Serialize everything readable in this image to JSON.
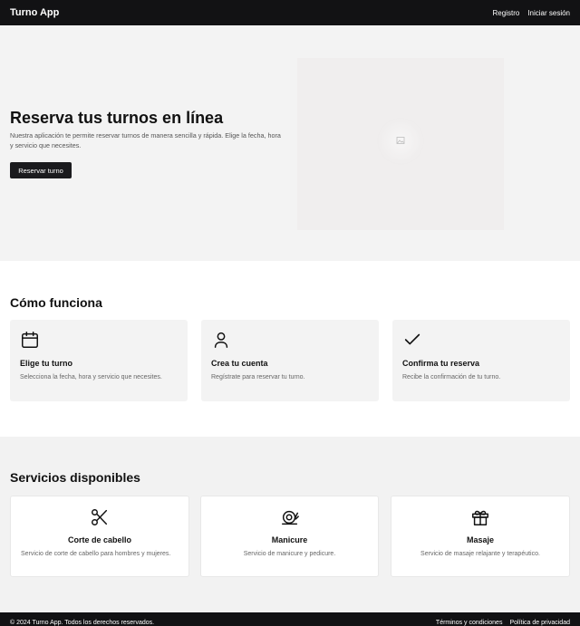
{
  "header": {
    "brand": "Turno App",
    "nav": [
      "Registro",
      "Iniciar sesión"
    ]
  },
  "hero": {
    "title": "Reserva tus turnos en línea",
    "text": "Nuestra aplicación te permite reservar turnos de manera sencilla y rápida. Elige la fecha, hora y servicio que necesites.",
    "button": "Reservar turno",
    "image_icon": "image-icon"
  },
  "how": {
    "title": "Cómo funciona",
    "cards": [
      {
        "icon": "calendar-icon",
        "title": "Elige tu turno",
        "desc": "Selecciona la fecha, hora y servicio que necesites."
      },
      {
        "icon": "user-icon",
        "title": "Crea tu cuenta",
        "desc": "Regístrate para reservar tu turno."
      },
      {
        "icon": "check-icon",
        "title": "Confirma tu reserva",
        "desc": "Recibe la confirmación de tu turno."
      }
    ]
  },
  "services": {
    "title": "Servicios disponibles",
    "cards": [
      {
        "icon": "scissors-icon",
        "title": "Corte de cabello",
        "desc": "Servicio de corte de cabello para hombres y mujeres."
      },
      {
        "icon": "snail-icon",
        "title": "Manicure",
        "desc": "Servicio de manicure y pedicure."
      },
      {
        "icon": "gift-icon",
        "title": "Masaje",
        "desc": "Servicio de masaje relajante y terapéutico."
      }
    ]
  },
  "footer": {
    "copyright": "© 2024 Turno App. Todos los derechos reservados.",
    "links": [
      "Términos y condiciones",
      "Política de privacidad"
    ]
  },
  "colors": {
    "dark": "#121214",
    "hero_bg": "#f3f3f3",
    "card_bg": "#f3f3f3"
  }
}
